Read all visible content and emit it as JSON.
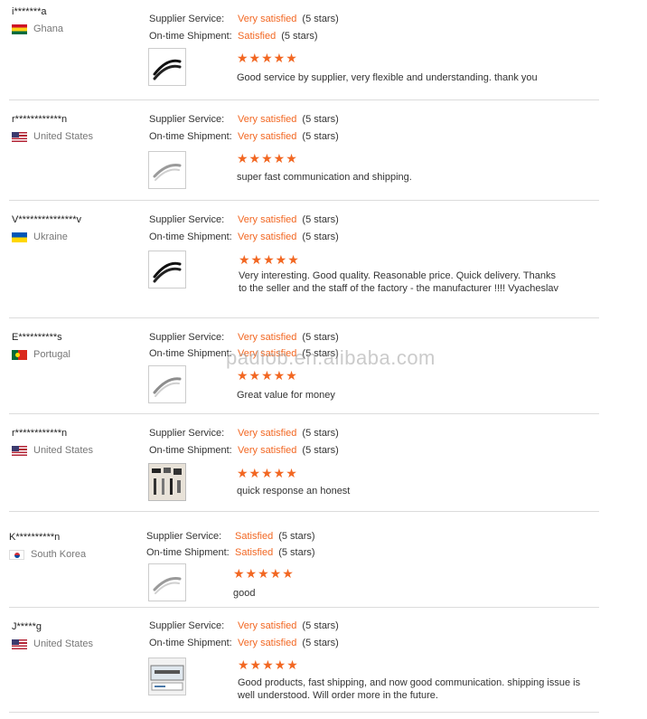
{
  "labels": {
    "supplier": "Supplier Service:",
    "shipment": "On-time Shipment:"
  },
  "stars_glyph": "★★★★★",
  "watermark": "padiob.en.alibaba.com",
  "colors": {
    "accent": "#f26722"
  },
  "reviews": [
    {
      "buyer": "i*******a",
      "country": "Ghana",
      "flag": "flag-ghana-icon",
      "supplier_rating": "Very satisfied",
      "supplier_stars": "(5 stars)",
      "shipment_rating": "Satisfied",
      "shipment_stars": "(5 stars)",
      "stars": 5,
      "thumb": "black-handle-icon",
      "comment": "Good service by supplier, very flexible and understanding. thank you"
    },
    {
      "buyer": "r************n",
      "country": "United States",
      "flag": "flag-us-icon",
      "supplier_rating": "Very satisfied",
      "supplier_stars": "(5 stars)",
      "shipment_rating": "Very satisfied",
      "shipment_stars": "(5 stars)",
      "stars": 5,
      "thumb": "silver-handle-icon",
      "comment": "super fast communication and shipping."
    },
    {
      "buyer": "V***************v",
      "country": "Ukraine",
      "flag": "flag-ukraine-icon",
      "supplier_rating": "Very satisfied",
      "supplier_stars": "(5 stars)",
      "shipment_rating": "Very satisfied",
      "shipment_stars": "(5 stars)",
      "stars": 5,
      "thumb": "black-handle-icon",
      "comment": "Very interesting. Good quality. Reasonable price. Quick delivery. Thanks to the seller and the staff of the factory - the manufacturer !!!! Vyacheslav"
    },
    {
      "buyer": "E**********s",
      "country": "Portugal",
      "flag": "flag-portugal-icon",
      "supplier_rating": "Very satisfied",
      "supplier_stars": "(5 stars)",
      "shipment_rating": "Very satisfied",
      "shipment_stars": "(5 stars)",
      "stars": 5,
      "thumb": "silver-handle-icon",
      "comment": "Great value for money"
    },
    {
      "buyer": "r************n",
      "country": "United States",
      "flag": "flag-us-icon",
      "supplier_rating": "Very satisfied",
      "supplier_stars": "(5 stars)",
      "shipment_rating": "Very satisfied",
      "shipment_stars": "(5 stars)",
      "stars": 5,
      "thumb": "handles-set-photo-icon",
      "comment": "quick response an honest"
    },
    {
      "buyer": "K**********n",
      "country": "South Korea",
      "flag": "flag-south-korea-icon",
      "supplier_rating": "Satisfied",
      "supplier_stars": "(5 stars)",
      "shipment_rating": "Satisfied",
      "shipment_stars": "(5 stars)",
      "stars": 5,
      "thumb": "silver-handle-icon",
      "comment": "good"
    },
    {
      "buyer": "J*****g",
      "country": "United States",
      "flag": "flag-us-icon",
      "supplier_rating": "Very satisfied",
      "supplier_stars": "(5 stars)",
      "shipment_rating": "Very satisfied",
      "shipment_stars": "(5 stars)",
      "stars": 5,
      "thumb": "boxed-handle-photo-icon",
      "comment": "Good products, fast shipping, and now good communication. shipping issue is well understood.  Will order more in the future."
    }
  ]
}
